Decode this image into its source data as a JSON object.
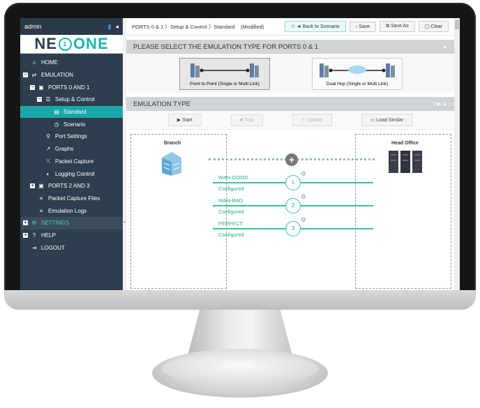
{
  "sidebar": {
    "user": "admin",
    "logo_a": "NE",
    "logo_b": "1",
    "logo_c": "ONE",
    "items": [
      {
        "label": "HOME",
        "icon": "home-icon",
        "glyph": "⌂",
        "prefix": ""
      },
      {
        "label": "EMULATION",
        "icon": "arrows-icon",
        "glyph": "⇄",
        "prefix": "−"
      },
      {
        "label": "PORTS 0 AND 1",
        "icon": "ports-icon",
        "glyph": "▣",
        "prefix": "−"
      },
      {
        "label": "Setup & Control",
        "icon": "sliders-icon",
        "glyph": "☰",
        "prefix": "−"
      },
      {
        "label": "Standard",
        "icon": "document-icon",
        "glyph": "▤",
        "prefix": ""
      },
      {
        "label": "Scenario",
        "icon": "clock-icon",
        "glyph": "◷",
        "prefix": ""
      },
      {
        "label": "Port Settings",
        "icon": "network-icon",
        "glyph": "⚲",
        "prefix": ""
      },
      {
        "label": "Graphs",
        "icon": "chart-icon",
        "glyph": "↗",
        "prefix": ""
      },
      {
        "label": "Packet Capture",
        "icon": "share-icon",
        "glyph": "⤫",
        "prefix": ""
      },
      {
        "label": "Logging Control",
        "icon": "toggle-icon",
        "glyph": "◐",
        "prefix": ""
      },
      {
        "label": "PORTS 2 AND 3",
        "icon": "ports-icon",
        "glyph": "▣",
        "prefix": "+"
      },
      {
        "label": "Packet Capture Files",
        "icon": "list-icon",
        "glyph": "≡",
        "prefix": ""
      },
      {
        "label": "Emulation Logs",
        "icon": "list-icon",
        "glyph": "≡",
        "prefix": ""
      },
      {
        "label": "SETTINGS",
        "icon": "gears-icon",
        "glyph": "⚙",
        "prefix": "+"
      },
      {
        "label": "HELP",
        "icon": "help-icon",
        "glyph": "?",
        "prefix": "+"
      },
      {
        "label": "LOGOUT",
        "icon": "logout-icon",
        "glyph": "⇥",
        "prefix": ""
      }
    ]
  },
  "header": {
    "breadcrumb": "PORTS 0 & 1 〉Setup & Control 〉Standard",
    "modified": "(Modified)",
    "back_label": "◄ Back to Scenario",
    "save_label": "Save",
    "save_as_label": "Save As",
    "clear_label": "Clear"
  },
  "select_panel": {
    "title": "PLEASE SELECT THE EMULATION TYPE FOR PORTS 0 & 1",
    "option1": "Point to Point (Single or Multi Link)",
    "option2": "Dual Hop (Single or Multi Link)"
  },
  "emulation_panel": {
    "title": "EMULATION TYPE",
    "start": "Start",
    "stop": "Stop",
    "update": "Update",
    "load_similar": "Load Similar"
  },
  "topology": {
    "left_site": "Branch",
    "right_site": "Head Office",
    "links": [
      {
        "num": "1",
        "name": "WAN-GOOD",
        "status": "Configured"
      },
      {
        "num": "2",
        "name": "WAN-BAD",
        "status": "Configured"
      },
      {
        "num": "3",
        "name": "PERFECT",
        "status": "Configured"
      }
    ]
  },
  "colors": {
    "sidebar": "#2d3e4e",
    "accent": "#1aa7a7",
    "link": "#36c39a"
  }
}
